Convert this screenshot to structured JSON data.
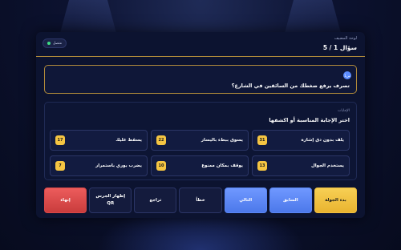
{
  "header": {
    "board_label": "لوحة المضيف",
    "question_counter": "سؤال 1 / 5",
    "status": "متصل"
  },
  "question": {
    "badge": "س1",
    "text": "تصرف يرفع ضغطك من السائقين في الشارع؟"
  },
  "answers": {
    "label": "الإجابات",
    "heading": "اختر الإجابة المناسبة أو اكشفها",
    "items": [
      {
        "text": "يلف بدون دق إشارة",
        "score": "31"
      },
      {
        "text": "يسوق ببطء باليسار",
        "score": "22"
      },
      {
        "text": "يسقط عليك",
        "score": "17"
      },
      {
        "text": "يستخدم الجوال",
        "score": "13"
      },
      {
        "text": "يوقف بمكان ممنوع",
        "score": "10"
      },
      {
        "text": "يضرب بوري باستمرار",
        "score": "7"
      }
    ]
  },
  "controls": {
    "start_round": "بدء الجولة",
    "previous": "السابق",
    "next": "التالي",
    "wrong": "خطأ",
    "undo": "تراجع",
    "show_qr": "إظهار الجرس\nQR",
    "finish": "إنهاء"
  },
  "colors": {
    "accent_gold": "#f5c542",
    "accent_blue": "#5b8cff",
    "danger_red": "#d94848",
    "status_green": "#3ddc84"
  }
}
